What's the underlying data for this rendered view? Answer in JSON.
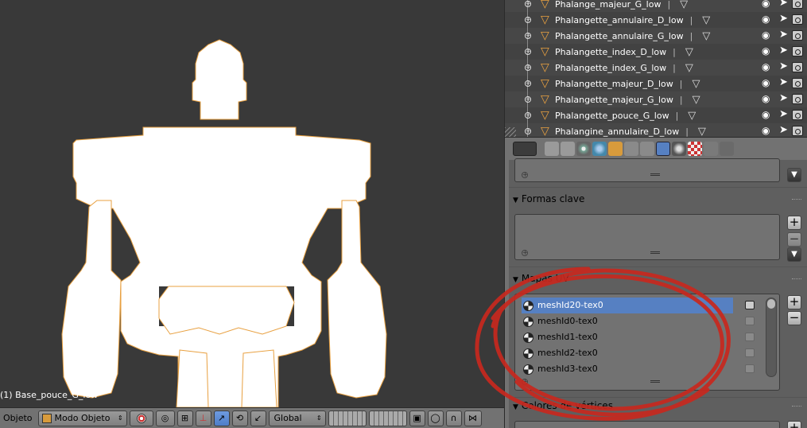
{
  "viewport": {
    "object_label": "(1) Base_pouce_G_low"
  },
  "header": {
    "menu_object": "Objeto",
    "mode": "Modo Objeto",
    "orientation": "Global"
  },
  "outliner": {
    "rows": [
      {
        "name": "Phalange_majeur_G_low"
      },
      {
        "name": "Phalangette_annulaire_D_low"
      },
      {
        "name": "Phalangette_annulaire_G_low"
      },
      {
        "name": "Phalangette_index_D_low"
      },
      {
        "name": "Phalangette_index_G_low"
      },
      {
        "name": "Phalangette_majeur_D_low"
      },
      {
        "name": "Phalangette_majeur_G_low"
      },
      {
        "name": "Phalangette_pouce_G_low"
      },
      {
        "name": "Phalangine_annulaire_D_low"
      }
    ],
    "separator": "|"
  },
  "properties": {
    "shape_keys_title": "Formas clave",
    "uv_maps_title": "Mapas UV",
    "vertex_colors_title": "Colores de vértices",
    "uv_maps": [
      {
        "name": "meshId20-tex0",
        "active": true
      },
      {
        "name": "meshId0-tex0",
        "active": false
      },
      {
        "name": "meshId1-tex0",
        "active": false
      },
      {
        "name": "meshId2-tex0",
        "active": false
      },
      {
        "name": "meshId3-tex0",
        "active": false
      }
    ],
    "add_symbol": "+",
    "remove_symbol": "−"
  },
  "colors": {
    "viewport_bg": "#393939",
    "panel_bg": "#727272",
    "active_row": "#5680c2",
    "selection_outline": "#e8a040",
    "annotation_circle": "#c8281e"
  }
}
